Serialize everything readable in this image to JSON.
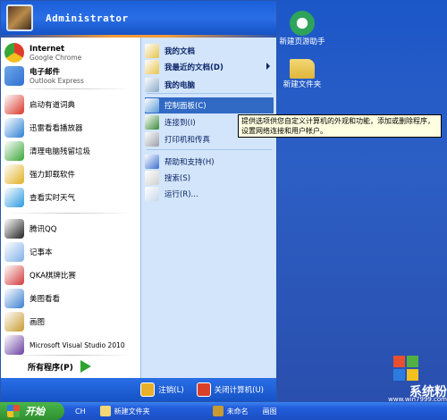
{
  "user": {
    "name": "Administrator"
  },
  "pinned": [
    {
      "id": "chrome",
      "title": "Internet",
      "subtitle": "Google Chrome",
      "icon": "chrome-icon",
      "color": "#e03c2c"
    },
    {
      "id": "outlook",
      "title": "电子邮件",
      "subtitle": "Outlook Express",
      "icon": "outlook-icon",
      "color": "#2f6fd2"
    }
  ],
  "recent": [
    {
      "label": "启动有道词典",
      "icon": "youdao-icon",
      "color": "#d9362b"
    },
    {
      "label": "迅雷看看播放器",
      "icon": "xunlei-icon",
      "color": "#2b7fd4"
    },
    {
      "label": "清理电脑残留垃圾",
      "icon": "cleanup-icon",
      "color": "#3aa63a"
    },
    {
      "label": "强力卸载软件",
      "icon": "uninstall-icon",
      "color": "#e0b020"
    },
    {
      "label": "查看实时天气",
      "icon": "weather-icon",
      "color": "#2c9ae0"
    },
    {
      "label": "腾讯QQ",
      "icon": "qq-icon",
      "color": "#222222"
    },
    {
      "label": "记事本",
      "icon": "notepad-icon",
      "color": "#7fb0e8"
    },
    {
      "label": "QKA棋牌比赛",
      "icon": "qka-icon",
      "color": "#d23a3a"
    },
    {
      "label": "美图看看",
      "icon": "meitu-icon",
      "color": "#3a7fd0"
    },
    {
      "label": "画图",
      "icon": "paint-icon",
      "color": "#c89a30"
    },
    {
      "label": "Microsoft Visual Studio 2010",
      "icon": "visual-studio-icon",
      "color": "#6a3fa0"
    }
  ],
  "all_programs": {
    "label": "所有程序(P)"
  },
  "places": [
    {
      "label": "我的文档",
      "icon": "my-documents-icon",
      "color": "#e8c24a",
      "bold": true
    },
    {
      "label": "我最近的文档(D)",
      "icon": "recent-documents-icon",
      "color": "#e8c24a",
      "bold": true,
      "arrow": true
    },
    {
      "label": "我的电脑",
      "icon": "my-computer-icon",
      "color": "#8aa8c8",
      "bold": true
    },
    {
      "label": "控制面板(C)",
      "icon": "control-panel-icon",
      "color": "#5a9ad8",
      "highlight": true
    },
    {
      "label": "连接到(I)",
      "icon": "connect-to-icon",
      "color": "#3a8a3a"
    },
    {
      "label": "打印机和传真",
      "icon": "printer-icon",
      "color": "#9aa0a8"
    },
    {
      "label": "帮助和支持(H)",
      "icon": "help-icon",
      "color": "#3a6fd0"
    },
    {
      "label": "搜索(S)",
      "icon": "search-icon",
      "color": "#d0d0d0"
    },
    {
      "label": "运行(R)...",
      "icon": "run-icon",
      "color": "#c8d8ea"
    }
  ],
  "footer": {
    "logoff": "注销(L)",
    "shutdown": "关闭计算机(U)"
  },
  "tooltip": {
    "text": "提供选项供您自定义计算机的外观和功能，添加或删除程序，设置网络连接和用户帐户。"
  },
  "desktop_icons": [
    {
      "label": "新建页游助手",
      "icon": "browser-assistant-icon"
    },
    {
      "label": "新建文件夹",
      "icon": "folder-icon"
    }
  ],
  "taskbar": {
    "start_label": "开始",
    "items": [
      {
        "label": "CH",
        "icon": "language-icon"
      },
      {
        "label": "新建文件夹",
        "icon": "folder-icon"
      },
      {
        "label": "未命名",
        "icon": "untitled-icon"
      },
      {
        "label": "画图",
        "icon": "paint-icon"
      }
    ]
  },
  "watermark": {
    "text": "系统粉",
    "url": "www.win7999.com"
  }
}
